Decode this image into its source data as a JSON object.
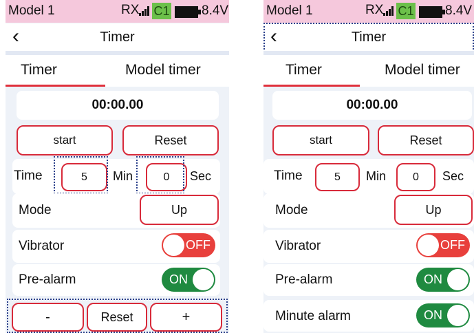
{
  "status": {
    "model": "Model 1",
    "rx": "RX",
    "channel": "C1",
    "voltage": "8.4V"
  },
  "header": {
    "title": "Timer"
  },
  "tabs": [
    {
      "label": "Timer"
    },
    {
      "label": "Model timer"
    }
  ],
  "timer": {
    "value": "00:00.00"
  },
  "buttons": {
    "start": "start",
    "reset": "Reset"
  },
  "time_row": {
    "label": "Time",
    "minutes": "5",
    "min_unit": "Min",
    "seconds": "0",
    "sec_unit": "Sec"
  },
  "mode": {
    "label": "Mode",
    "value": "Up"
  },
  "vibrator": {
    "label": "Vibrator",
    "state": "OFF"
  },
  "pre_alarm": {
    "label": "Pre-alarm",
    "state": "ON"
  },
  "minute_alarm": {
    "label": "Minute alarm",
    "state": "ON"
  },
  "keypad": {
    "minus": "-",
    "reset": "Reset",
    "plus": "+"
  },
  "colors": {
    "accent": "#d82a3a",
    "status_bar": "#f5c8dc",
    "on": "#1f8a40",
    "off": "#e8403c",
    "channel_badge": "#6cc04a"
  }
}
